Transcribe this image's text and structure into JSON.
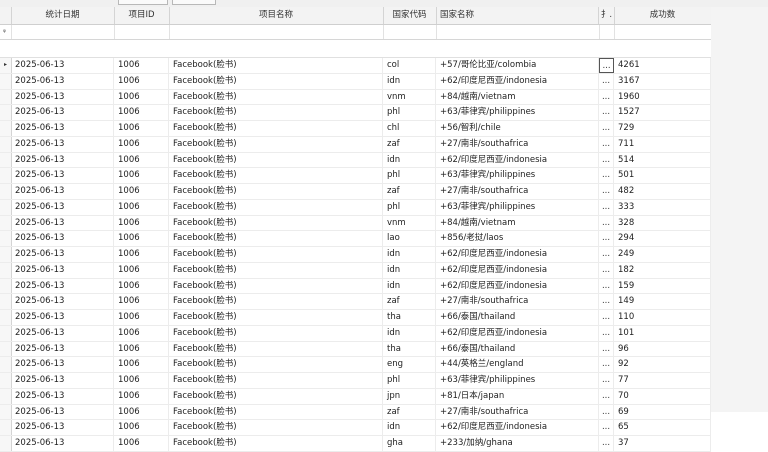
{
  "columns": [
    {
      "key": "indicator",
      "label": ""
    },
    {
      "key": "date",
      "label": "统计日期"
    },
    {
      "key": "pid",
      "label": "项目ID"
    },
    {
      "key": "pname",
      "label": "项目名称"
    },
    {
      "key": "code",
      "label": "国家代码"
    },
    {
      "key": "country",
      "label": "国家名称"
    },
    {
      "key": "ops",
      "label": "扌."
    },
    {
      "key": "count",
      "label": "成功数"
    }
  ],
  "filter_icon": "pin-icon",
  "filter_glyph": "ᵩ",
  "current_row_glyph": "▸",
  "ellipsis": "...",
  "rows": [
    {
      "date": "2025-06-13",
      "pid": "1006",
      "pname": "Facebook(脸书)",
      "code": "col",
      "country": "+57/哥伦比亚/colombia",
      "count": "4261"
    },
    {
      "date": "2025-06-13",
      "pid": "1006",
      "pname": "Facebook(脸书)",
      "code": "idn",
      "country": "+62/印度尼西亚/indonesia",
      "count": "3167"
    },
    {
      "date": "2025-06-13",
      "pid": "1006",
      "pname": "Facebook(脸书)",
      "code": "vnm",
      "country": "+84/越南/vietnam",
      "count": "1960"
    },
    {
      "date": "2025-06-13",
      "pid": "1006",
      "pname": "Facebook(脸书)",
      "code": "phl",
      "country": "+63/菲律宾/philippines",
      "count": "1527"
    },
    {
      "date": "2025-06-13",
      "pid": "1006",
      "pname": "Facebook(脸书)",
      "code": "chl",
      "country": "+56/智利/chile",
      "count": "729"
    },
    {
      "date": "2025-06-13",
      "pid": "1006",
      "pname": "Facebook(脸书)",
      "code": "zaf",
      "country": "+27/南非/southafrica",
      "count": "711"
    },
    {
      "date": "2025-06-13",
      "pid": "1006",
      "pname": "Facebook(脸书)",
      "code": "idn",
      "country": "+62/印度尼西亚/indonesia",
      "count": "514"
    },
    {
      "date": "2025-06-13",
      "pid": "1006",
      "pname": "Facebook(脸书)",
      "code": "phl",
      "country": "+63/菲律宾/philippines",
      "count": "501"
    },
    {
      "date": "2025-06-13",
      "pid": "1006",
      "pname": "Facebook(脸书)",
      "code": "zaf",
      "country": "+27/南非/southafrica",
      "count": "482"
    },
    {
      "date": "2025-06-13",
      "pid": "1006",
      "pname": "Facebook(脸书)",
      "code": "phl",
      "country": "+63/菲律宾/philippines",
      "count": "333"
    },
    {
      "date": "2025-06-13",
      "pid": "1006",
      "pname": "Facebook(脸书)",
      "code": "vnm",
      "country": "+84/越南/vietnam",
      "count": "328"
    },
    {
      "date": "2025-06-13",
      "pid": "1006",
      "pname": "Facebook(脸书)",
      "code": "lao",
      "country": "+856/老挝/laos",
      "count": "294"
    },
    {
      "date": "2025-06-13",
      "pid": "1006",
      "pname": "Facebook(脸书)",
      "code": "idn",
      "country": "+62/印度尼西亚/indonesia",
      "count": "249"
    },
    {
      "date": "2025-06-13",
      "pid": "1006",
      "pname": "Facebook(脸书)",
      "code": "idn",
      "country": "+62/印度尼西亚/indonesia",
      "count": "182"
    },
    {
      "date": "2025-06-13",
      "pid": "1006",
      "pname": "Facebook(脸书)",
      "code": "idn",
      "country": "+62/印度尼西亚/indonesia",
      "count": "159"
    },
    {
      "date": "2025-06-13",
      "pid": "1006",
      "pname": "Facebook(脸书)",
      "code": "zaf",
      "country": "+27/南非/southafrica",
      "count": "149"
    },
    {
      "date": "2025-06-13",
      "pid": "1006",
      "pname": "Facebook(脸书)",
      "code": "tha",
      "country": "+66/泰国/thailand",
      "count": "110"
    },
    {
      "date": "2025-06-13",
      "pid": "1006",
      "pname": "Facebook(脸书)",
      "code": "idn",
      "country": "+62/印度尼西亚/indonesia",
      "count": "101"
    },
    {
      "date": "2025-06-13",
      "pid": "1006",
      "pname": "Facebook(脸书)",
      "code": "tha",
      "country": "+66/泰国/thailand",
      "count": "96"
    },
    {
      "date": "2025-06-13",
      "pid": "1006",
      "pname": "Facebook(脸书)",
      "code": "eng",
      "country": "+44/英格兰/england",
      "count": "92"
    },
    {
      "date": "2025-06-13",
      "pid": "1006",
      "pname": "Facebook(脸书)",
      "code": "phl",
      "country": "+63/菲律宾/philippines",
      "count": "77"
    },
    {
      "date": "2025-06-13",
      "pid": "1006",
      "pname": "Facebook(脸书)",
      "code": "jpn",
      "country": "+81/日本/japan",
      "count": "70"
    },
    {
      "date": "2025-06-13",
      "pid": "1006",
      "pname": "Facebook(脸书)",
      "code": "zaf",
      "country": "+27/南非/southafrica",
      "count": "69"
    },
    {
      "date": "2025-06-13",
      "pid": "1006",
      "pname": "Facebook(脸书)",
      "code": "idn",
      "country": "+62/印度尼西亚/indonesia",
      "count": "65"
    },
    {
      "date": "2025-06-13",
      "pid": "1006",
      "pname": "Facebook(脸书)",
      "code": "gha",
      "country": "+233/加纳/ghana",
      "count": "37"
    }
  ]
}
